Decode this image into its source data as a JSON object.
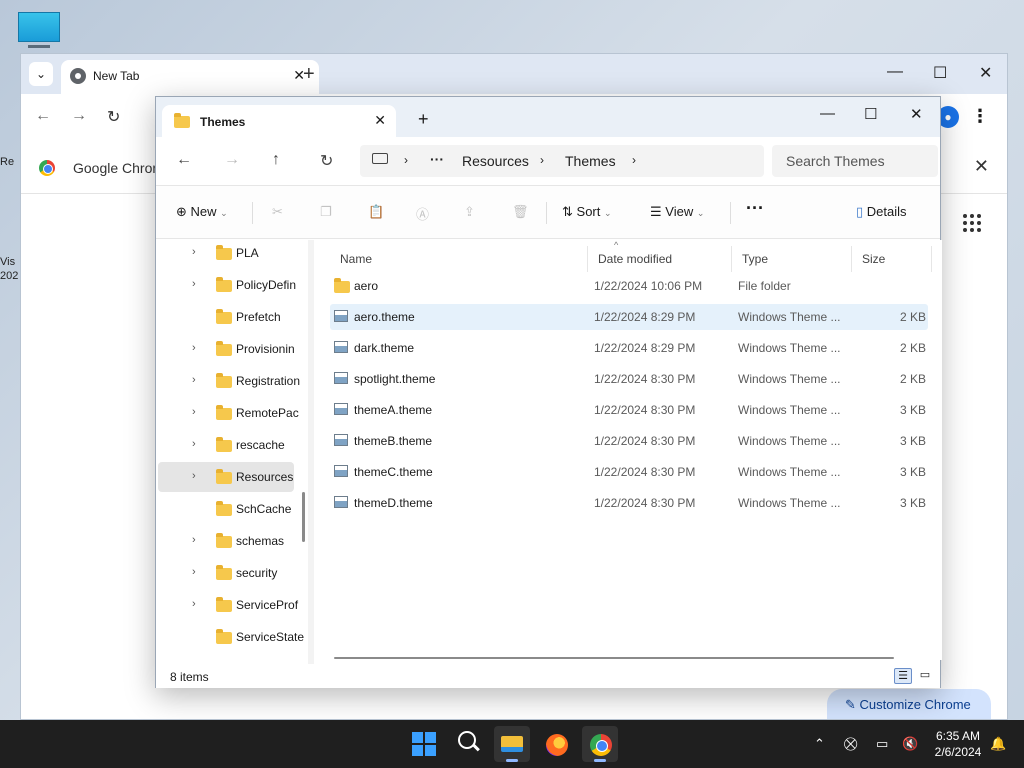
{
  "desktop": {
    "side_labels": [
      "Re",
      "Vis",
      "202"
    ]
  },
  "chrome": {
    "tab_title": "New Tab",
    "bookmark_label": "Google Chrom",
    "customize_label": "Customize Chrome"
  },
  "explorer": {
    "tab_title": "Themes",
    "breadcrumb": [
      "Resources",
      "Themes"
    ],
    "search_placeholder": "Search Themes",
    "commands": {
      "new": "New",
      "sort": "Sort",
      "view": "View",
      "details": "Details"
    },
    "nav_items": [
      {
        "label": "PLA",
        "expandable": true
      },
      {
        "label": "PolicyDefin",
        "expandable": true
      },
      {
        "label": "Prefetch",
        "expandable": false
      },
      {
        "label": "Provisionin",
        "expandable": true
      },
      {
        "label": "Registration",
        "expandable": true
      },
      {
        "label": "RemotePac",
        "expandable": true
      },
      {
        "label": "rescache",
        "expandable": true
      },
      {
        "label": "Resources",
        "expandable": true,
        "selected": true
      },
      {
        "label": "SchCache",
        "expandable": false
      },
      {
        "label": "schemas",
        "expandable": true
      },
      {
        "label": "security",
        "expandable": true
      },
      {
        "label": "ServiceProf",
        "expandable": true
      },
      {
        "label": "ServiceState",
        "expandable": false
      }
    ],
    "columns": [
      "Name",
      "Date modified",
      "Type",
      "Size"
    ],
    "files": [
      {
        "name": "aero",
        "date": "1/22/2024 10:06 PM",
        "type": "File folder",
        "size": "",
        "kind": "folder"
      },
      {
        "name": "aero.theme",
        "date": "1/22/2024 8:29 PM",
        "type": "Windows Theme ...",
        "size": "2 KB",
        "kind": "theme",
        "hover": true
      },
      {
        "name": "dark.theme",
        "date": "1/22/2024 8:29 PM",
        "type": "Windows Theme ...",
        "size": "2 KB",
        "kind": "theme"
      },
      {
        "name": "spotlight.theme",
        "date": "1/22/2024 8:30 PM",
        "type": "Windows Theme ...",
        "size": "2 KB",
        "kind": "theme"
      },
      {
        "name": "themeA.theme",
        "date": "1/22/2024 8:30 PM",
        "type": "Windows Theme ...",
        "size": "3 KB",
        "kind": "theme"
      },
      {
        "name": "themeB.theme",
        "date": "1/22/2024 8:30 PM",
        "type": "Windows Theme ...",
        "size": "3 KB",
        "kind": "theme"
      },
      {
        "name": "themeC.theme",
        "date": "1/22/2024 8:30 PM",
        "type": "Windows Theme ...",
        "size": "3 KB",
        "kind": "theme"
      },
      {
        "name": "themeD.theme",
        "date": "1/22/2024 8:30 PM",
        "type": "Windows Theme ...",
        "size": "3 KB",
        "kind": "theme"
      }
    ],
    "status_count": "8 items"
  },
  "taskbar": {
    "time": "6:35 AM",
    "date": "2/6/2024"
  },
  "colors": {
    "accent": "#0067c0",
    "hover_row": "#e5f1fb",
    "taskbar": "#1f1f1f"
  }
}
